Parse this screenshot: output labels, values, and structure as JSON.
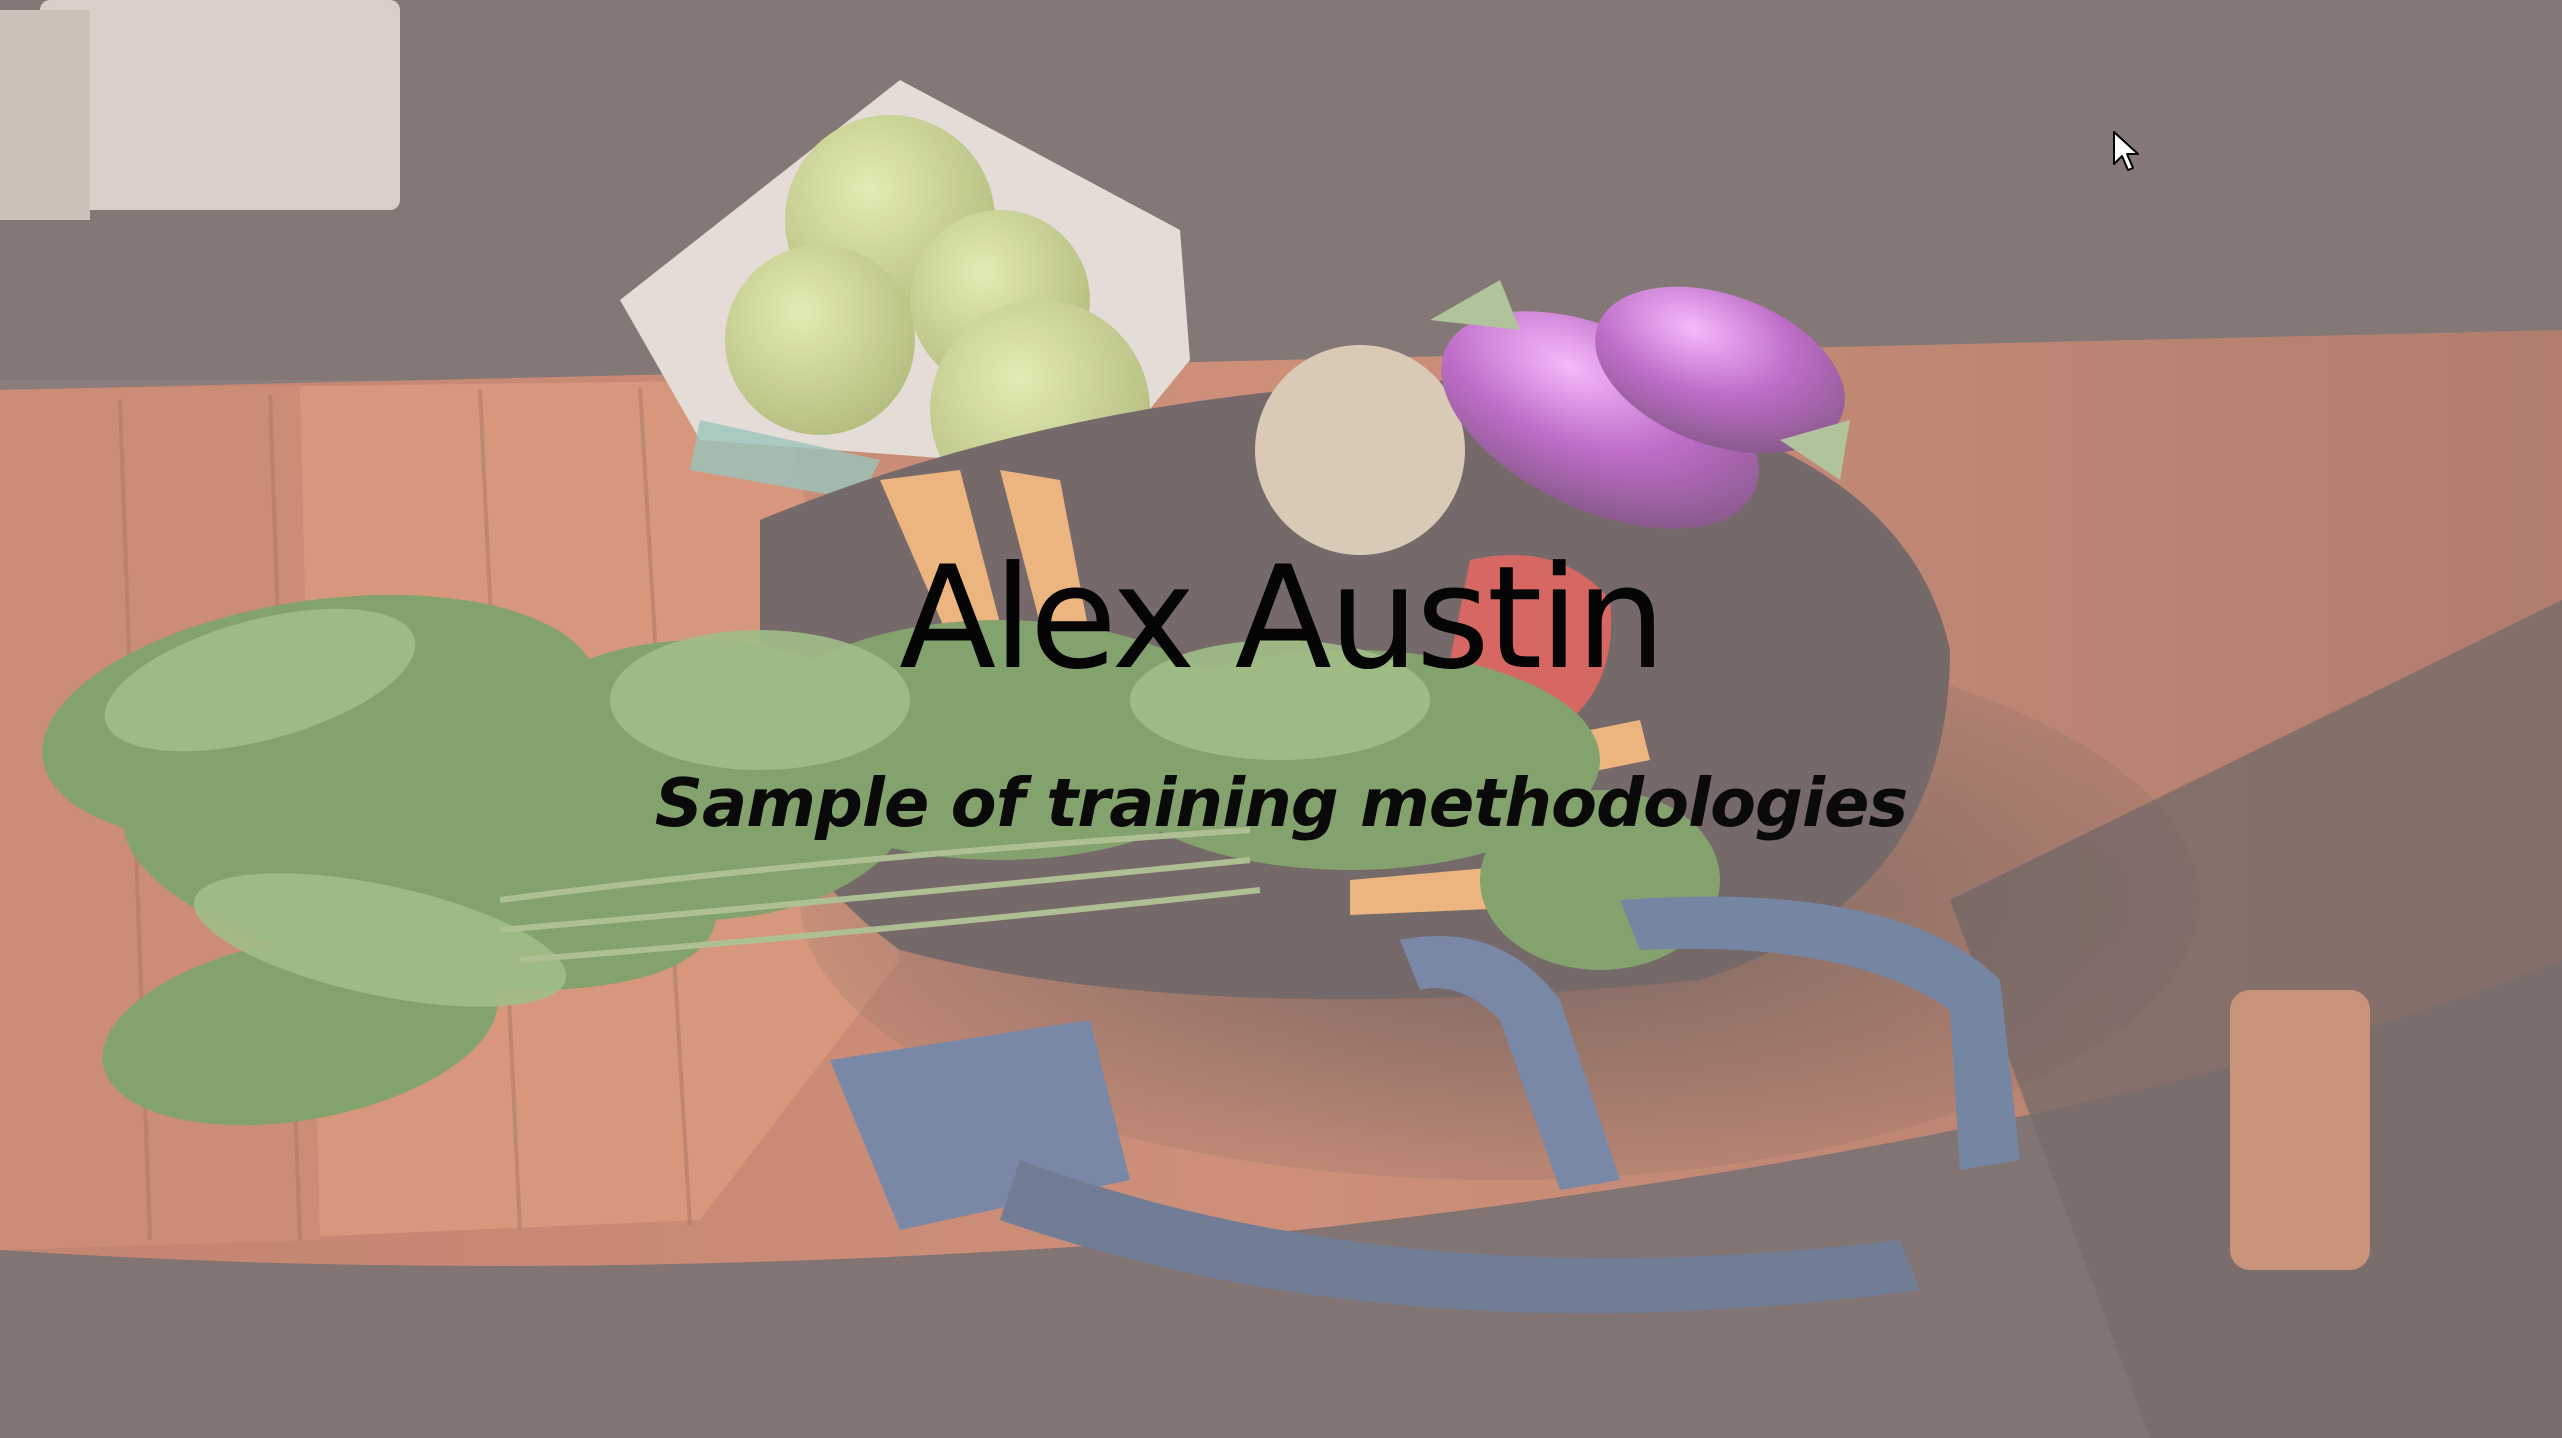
{
  "slide": {
    "title": "Alex Austin",
    "subtitle": "Sample of training methodologies"
  },
  "background_image": "vegetables-on-wooden-table-photo",
  "cursor_icon": "mouse-pointer-icon",
  "colors": {
    "text": "#050505",
    "wash": "#fff5f2"
  }
}
